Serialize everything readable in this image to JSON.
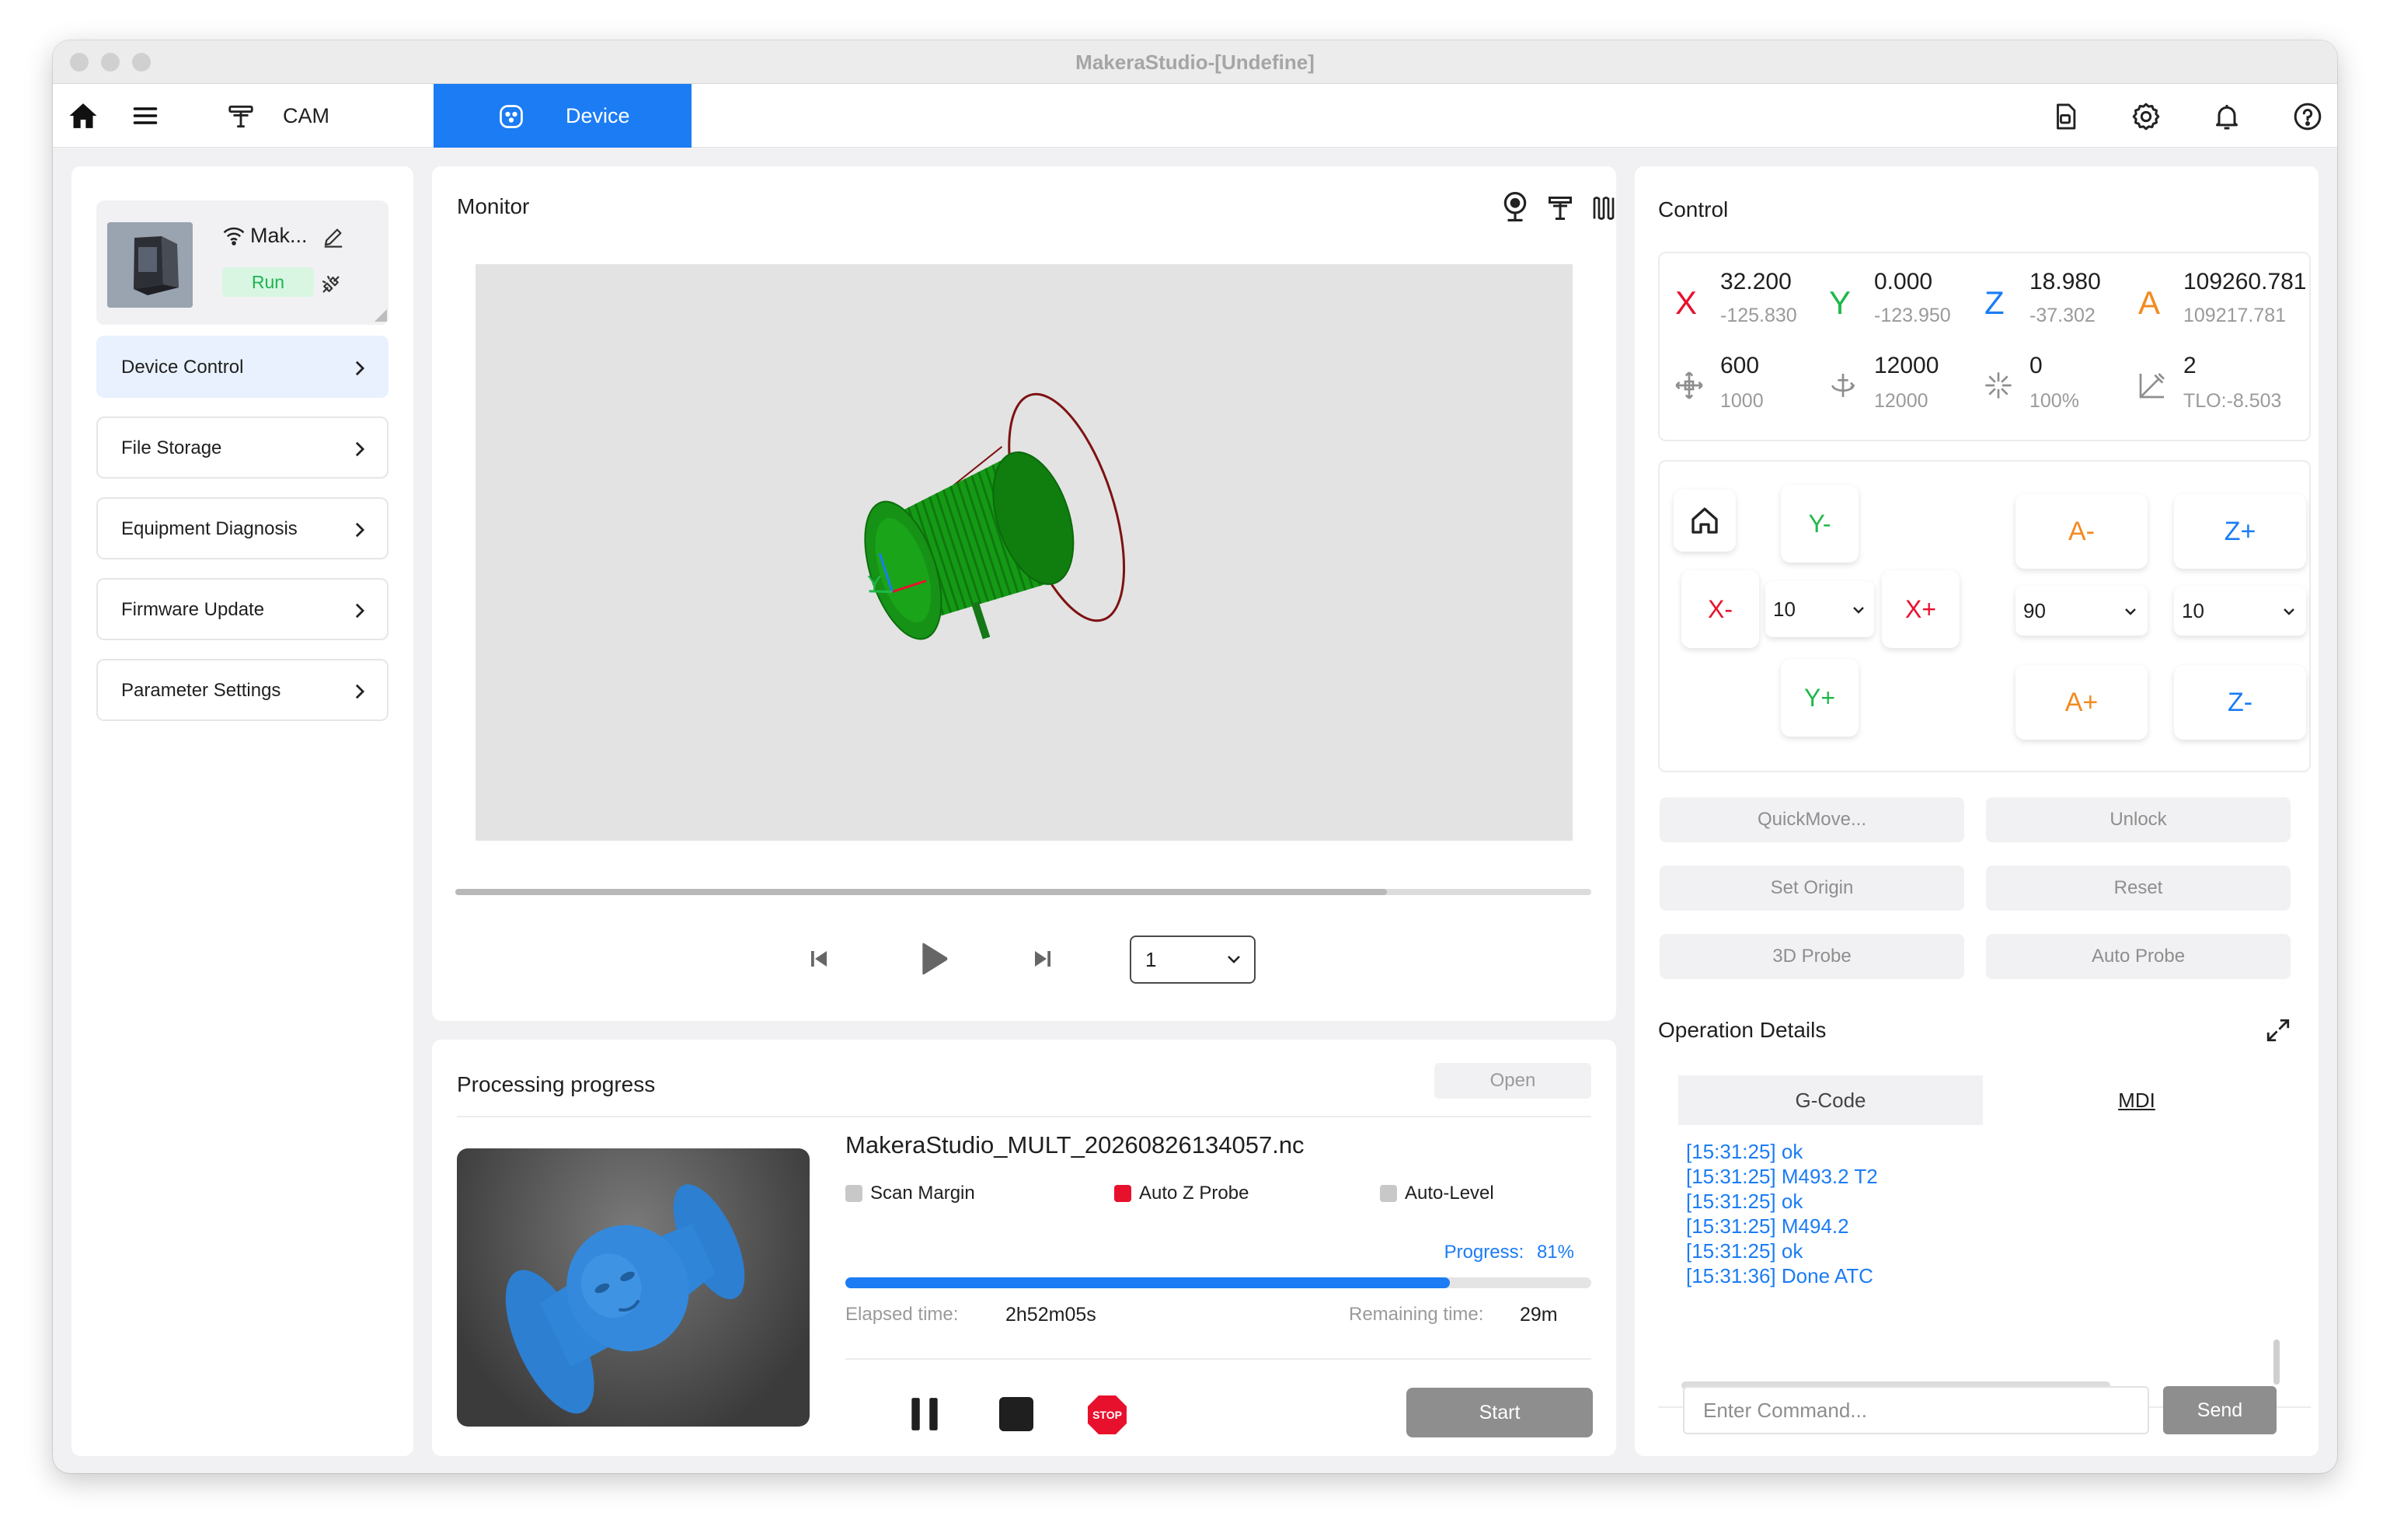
{
  "window": {
    "title": "MakeraStudio-[Undefine]"
  },
  "toolbar": {
    "tabs": [
      {
        "label": "CAM",
        "active": false
      },
      {
        "label": "Device",
        "active": true
      }
    ],
    "icons": [
      "home-icon",
      "menu-icon",
      "cam-icon",
      "device-icon",
      "save-file-icon",
      "gear-icon",
      "bell-icon",
      "help-icon"
    ]
  },
  "sidebar": {
    "device": {
      "name": "Mak...",
      "status": "Run"
    },
    "items": [
      {
        "label": "Device Control",
        "active": true
      },
      {
        "label": "File Storage",
        "active": false
      },
      {
        "label": "Equipment Diagnosis",
        "active": false
      },
      {
        "label": "Firmware Update",
        "active": false
      },
      {
        "label": "Parameter Settings",
        "active": false
      }
    ]
  },
  "monitor": {
    "title": "Monitor",
    "axis_label": "Y",
    "timeline_progress": 0.82,
    "speed_select": "1"
  },
  "processing": {
    "title": "Processing progress",
    "open_label": "Open",
    "filename": "MakeraStudio_MULT_20260826134057.nc",
    "options": [
      {
        "label": "Scan Margin",
        "checked": false,
        "color": "#c8c8c8"
      },
      {
        "label": "Auto Z Probe",
        "checked": true,
        "color": "#e8112d"
      },
      {
        "label": "Auto-Level",
        "checked": false,
        "color": "#c8c8c8"
      }
    ],
    "progress_label": "Progress:",
    "progress_value": "81%",
    "progress_fraction": 0.81,
    "elapsed_label": "Elapsed time:",
    "elapsed_value": "2h52m05s",
    "remaining_label": "Remaining time:",
    "remaining_value": "29m",
    "stop_label": "STOP",
    "start_label": "Start"
  },
  "control": {
    "title": "Control",
    "axes": [
      {
        "letter": "X",
        "color": "#e8112d",
        "value": "32.200",
        "sub": "-125.830"
      },
      {
        "letter": "Y",
        "color": "#20b84a",
        "value": "0.000",
        "sub": "-123.950"
      },
      {
        "letter": "Z",
        "color": "#1b7cf4",
        "value": "18.980",
        "sub": "-37.302"
      },
      {
        "letter": "A",
        "color": "#f28a1e",
        "value": "109260.781",
        "sub": "109217.781"
      }
    ],
    "stats": [
      {
        "icon": "feed-rate-icon",
        "value": "600",
        "sub": "1000"
      },
      {
        "icon": "spindle-speed-icon",
        "value": "12000",
        "sub": "12000"
      },
      {
        "icon": "laser-power-icon",
        "value": "0",
        "sub": "100%"
      },
      {
        "icon": "tool-icon",
        "value": "2",
        "sub": "TLO:-8.503"
      }
    ],
    "jog": {
      "y_minus": "Y-",
      "y_plus": "Y+",
      "x_minus": "X-",
      "x_plus": "X+",
      "a_minus": "A-",
      "a_plus": "A+",
      "z_plus": "Z+",
      "z_minus": "Z-",
      "xy_step": "10",
      "a_step": "90",
      "z_step": "10"
    },
    "actions": {
      "quick_move": "QuickMove...",
      "unlock": "Unlock",
      "set_origin": "Set Origin",
      "reset": "Reset",
      "probe_3d": "3D Probe",
      "auto_probe": "Auto Probe"
    }
  },
  "operation": {
    "title": "Operation Details",
    "tabs": [
      {
        "label": "G-Code",
        "active": false
      },
      {
        "label": "MDI",
        "active": true
      }
    ],
    "log": [
      "[15:31:25] ok",
      "[15:31:25] M493.2 T2",
      "[15:31:25] ok",
      "[15:31:25] M494.2",
      "[15:31:25] ok",
      "[15:31:36] Done ATC"
    ],
    "input_placeholder": "Enter Command...",
    "send_label": "Send"
  },
  "colors": {
    "accent": "#1b7cf4",
    "x_axis": "#e8112d",
    "y_axis": "#20b84a",
    "z_axis": "#1b7cf4",
    "a_axis": "#f28a1e",
    "model_green": "#168a16"
  }
}
